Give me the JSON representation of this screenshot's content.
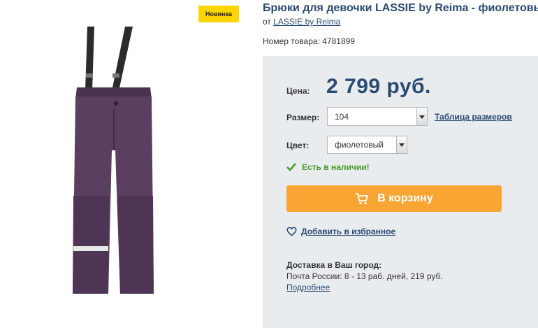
{
  "badge": "Новинка",
  "product": {
    "title": "Брюки для девочки LASSIE by Reima - фиолетовый",
    "brand_prefix": "от",
    "brand": "LASSIE by Reima",
    "sku_label": "Номер товара:",
    "sku": "4781899"
  },
  "price": {
    "label": "Цена:",
    "value": "2 799 руб."
  },
  "size": {
    "label": "Размер:",
    "selected": "104",
    "table_link": "Таблица размеров"
  },
  "color": {
    "label": "Цвет:",
    "selected": "фиолетовый"
  },
  "stock": "Есть в наличии!",
  "cart_button": "В корзину",
  "favorite": "Добавить в избранное",
  "delivery": {
    "heading": "Доставка в Ваш город:",
    "line": "Почта России: 8 - 13 раб. дней, 219 руб.",
    "more": "Подробнее"
  },
  "colors": {
    "accent": "#2a4a73",
    "button": "#f8a534",
    "badge": "#ffd500",
    "stock": "#4a9a2a",
    "panel": "#e9ecef"
  }
}
